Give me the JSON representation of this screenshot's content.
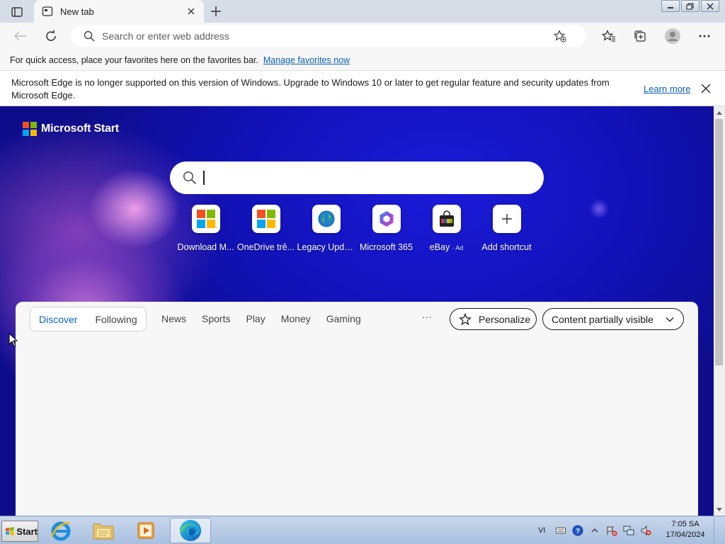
{
  "browser": {
    "tab_title": "New tab",
    "address_placeholder": "Search or enter web address",
    "favorites_bar_text": "For quick access, place your favorites here on the favorites bar.",
    "favorites_bar_link": "Manage favorites now"
  },
  "infobar": {
    "message": "Microsoft Edge is no longer supported on this version of Windows. Upgrade to Windows 10 or later to get regular feature and security updates from Microsoft Edge.",
    "learn_more": "Learn more"
  },
  "page": {
    "brand": "Microsoft Start",
    "search_placeholder": "",
    "shortcuts": [
      {
        "label": "Download M...",
        "icon": "microsoft-logo-icon"
      },
      {
        "label": "OneDrive trê...",
        "icon": "microsoft-logo-icon"
      },
      {
        "label": "Legacy Upda...",
        "icon": "globe-icon"
      },
      {
        "label": "Microsoft 365",
        "icon": "microsoft-365-icon"
      },
      {
        "label": "eBay",
        "ad": "Ad",
        "icon": "shopping-bag-icon"
      },
      {
        "label": "Add shortcut",
        "icon": "plus-icon"
      }
    ],
    "feed": {
      "pill_tabs": [
        "Discover",
        "Following"
      ],
      "active_tab": "Discover",
      "nav": [
        "News",
        "Sports",
        "Play",
        "Money",
        "Gaming"
      ],
      "more": "···",
      "personalize": "Personalize",
      "content_visibility": "Content partially visible"
    }
  },
  "taskbar": {
    "start_label": "Start",
    "tray_lang": "VI",
    "clock_time": "7:05 SA",
    "clock_date": "17/04/2024"
  },
  "colors": {
    "accent": "#0c63c7",
    "background_blue": "#1212b8",
    "taskbar": "#b8cbe5"
  }
}
